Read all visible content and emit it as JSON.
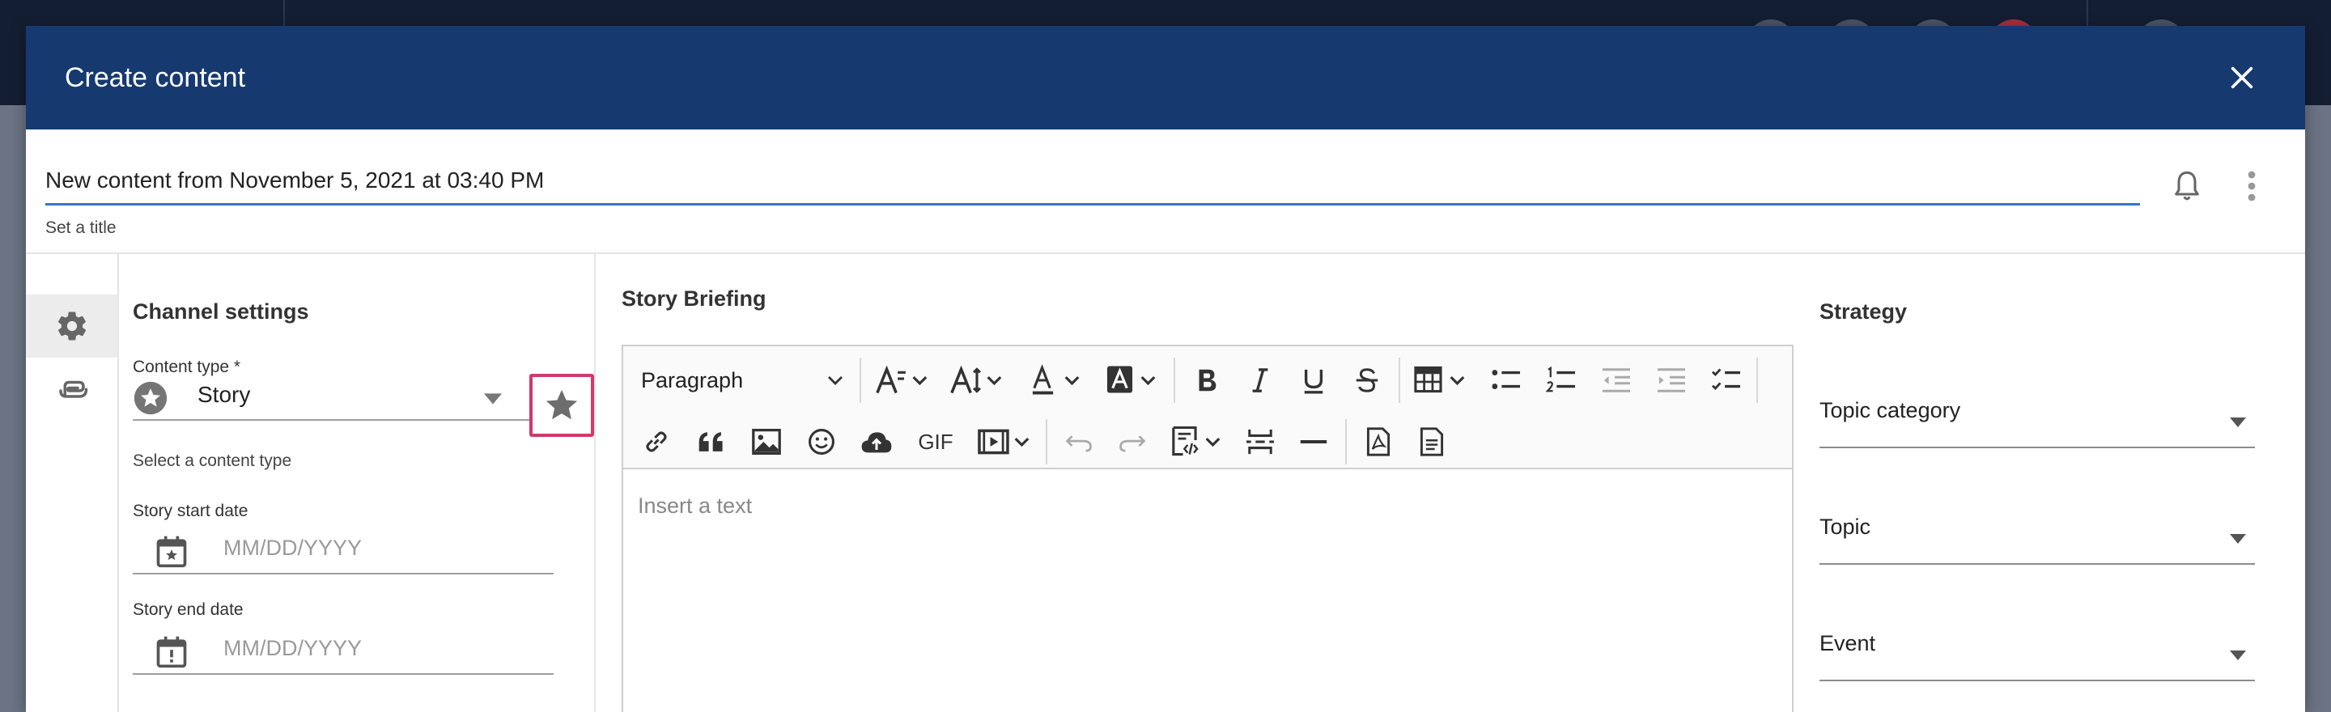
{
  "modal": {
    "title": "Create content",
    "close_icon": "close-icon"
  },
  "title_field": {
    "value": "New content from November 5, 2021 at 03:40 PM",
    "helper": "Set a title"
  },
  "header_actions": {
    "notifications_icon": "bell-icon",
    "more_icon": "more-vertical-icon"
  },
  "rail": {
    "items": [
      {
        "icon": "gear-icon",
        "active": true
      },
      {
        "icon": "paperclip-icon",
        "active": false
      }
    ]
  },
  "channel_settings": {
    "title": "Channel settings",
    "content_type": {
      "label": "Content type *",
      "value": "Story",
      "helper": "Select a content type"
    },
    "start_date": {
      "label": "Story start date",
      "placeholder": "MM/DD/YYYY"
    },
    "end_date": {
      "label": "Story end date",
      "placeholder": "MM/DD/YYYY"
    }
  },
  "briefing": {
    "title": "Story Briefing",
    "paragraph_style": "Paragraph",
    "gif_label": "GIF",
    "placeholder": "Insert a text"
  },
  "strategy": {
    "title": "Strategy",
    "fields": [
      {
        "label": "Topic category"
      },
      {
        "label": "Topic"
      },
      {
        "label": "Event"
      }
    ]
  },
  "colors": {
    "header_bg": "#163a70",
    "accent_underline": "#2f78c4",
    "highlight_border": "#cf3a6b"
  }
}
